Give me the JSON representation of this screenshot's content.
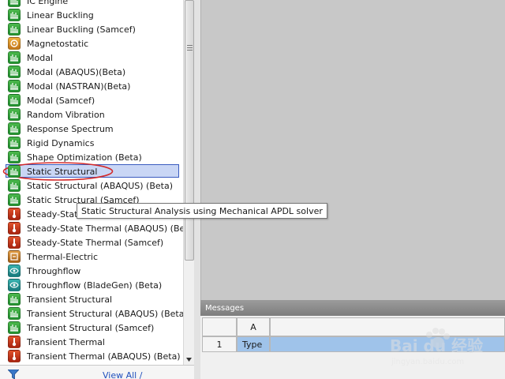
{
  "toolbox": {
    "items": [
      {
        "label": "IC Engine",
        "icon": "ic-engine-icon",
        "color": "green"
      },
      {
        "label": "Linear Buckling",
        "icon": "linear-buckling-icon",
        "color": "green"
      },
      {
        "label": "Linear Buckling (Samcef)",
        "icon": "linear-buckling-samcef-icon",
        "color": "green"
      },
      {
        "label": "Magnetostatic",
        "icon": "magnetostatic-icon",
        "color": "orange"
      },
      {
        "label": "Modal",
        "icon": "modal-icon",
        "color": "green"
      },
      {
        "label": "Modal (ABAQUS)(Beta)",
        "icon": "modal-abaqus-icon",
        "color": "green"
      },
      {
        "label": "Modal (NASTRAN)(Beta)",
        "icon": "modal-nastran-icon",
        "color": "green"
      },
      {
        "label": "Modal (Samcef)",
        "icon": "modal-samcef-icon",
        "color": "green"
      },
      {
        "label": "Random Vibration",
        "icon": "random-vibration-icon",
        "color": "green"
      },
      {
        "label": "Response Spectrum",
        "icon": "response-spectrum-icon",
        "color": "green"
      },
      {
        "label": "Rigid Dynamics",
        "icon": "rigid-dynamics-icon",
        "color": "green"
      },
      {
        "label": "Shape Optimization (Beta)",
        "icon": "shape-optimization-icon",
        "color": "green"
      },
      {
        "label": "Static Structural",
        "icon": "static-structural-icon",
        "color": "green",
        "selected": true
      },
      {
        "label": "Static Structural (ABAQUS) (Beta)",
        "icon": "static-structural-abaqus-icon",
        "color": "green"
      },
      {
        "label": "Static Structural (Samcef)",
        "icon": "static-structural-samcef-icon",
        "color": "green"
      },
      {
        "label": "Steady-State Thermal",
        "icon": "steady-state-thermal-icon",
        "color": "red"
      },
      {
        "label": "Steady-State Thermal (ABAQUS) (Beta)",
        "icon": "steady-state-thermal-abaqus-icon",
        "color": "red"
      },
      {
        "label": "Steady-State Thermal (Samcef)",
        "icon": "steady-state-thermal-samcef-icon",
        "color": "red"
      },
      {
        "label": "Thermal-Electric",
        "icon": "thermal-electric-icon",
        "color": "gold"
      },
      {
        "label": "Throughflow",
        "icon": "throughflow-icon",
        "color": "teal"
      },
      {
        "label": "Throughflow (BladeGen) (Beta)",
        "icon": "throughflow-bladegen-icon",
        "color": "teal"
      },
      {
        "label": "Transient Structural",
        "icon": "transient-structural-icon",
        "color": "green"
      },
      {
        "label": "Transient Structural (ABAQUS) (Beta)",
        "icon": "transient-structural-abaqus-icon",
        "color": "green"
      },
      {
        "label": "Transient Structural (Samcef)",
        "icon": "transient-structural-samcef-icon",
        "color": "green"
      },
      {
        "label": "Transient Thermal",
        "icon": "transient-thermal-icon",
        "color": "red"
      },
      {
        "label": "Transient Thermal (ABAQUS) (Beta)",
        "icon": "transient-thermal-abaqus-icon",
        "color": "red"
      }
    ],
    "view_all_label": "View All / Customize..."
  },
  "tooltip": {
    "text": "Static Structural Analysis using Mechanical APDL solver"
  },
  "messages": {
    "title": "Messages",
    "column_header": "A",
    "rows": [
      {
        "num": "1",
        "value": "Type"
      }
    ]
  },
  "watermark": {
    "text": "Bai du 经验",
    "sub": "jingyan.baidu.com"
  },
  "colors": {
    "selection_border": "#3a5bbf",
    "selection_fill": "#c9d6f5",
    "highlight_ellipse": "#d42a2a",
    "link": "#1f4fbd",
    "row_selected": "#9fc3ea"
  }
}
